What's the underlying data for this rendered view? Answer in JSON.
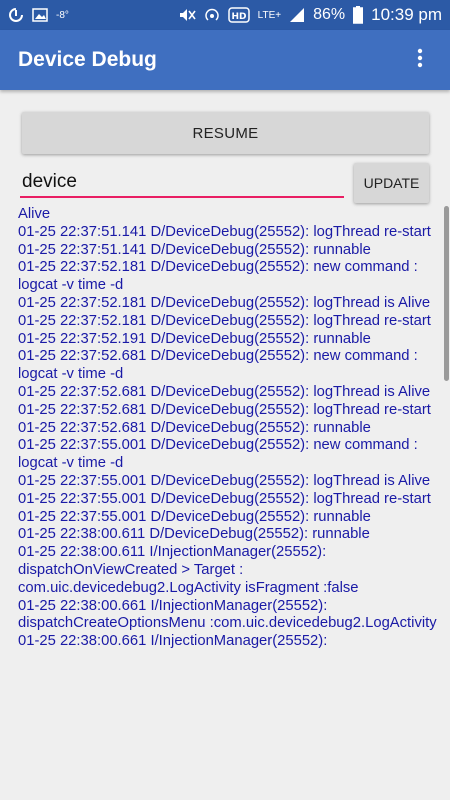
{
  "status_bar": {
    "temperature": "-8°",
    "network": "LTE+",
    "battery": "86%",
    "time": "10:39 pm"
  },
  "app_bar": {
    "title": "Device Debug"
  },
  "controls": {
    "resume_label": "RESUME",
    "filter_value": "device",
    "update_label": "UPDATE"
  },
  "log_lines": [
    "Alive",
    "01-25 22:37:51.141 D/DeviceDebug(25552): logThread re-start",
    "01-25 22:37:51.141 D/DeviceDebug(25552): runnable",
    "01-25 22:37:52.181 D/DeviceDebug(25552): new command : logcat -v time -d",
    "01-25 22:37:52.181 D/DeviceDebug(25552): logThread is Alive",
    "01-25 22:37:52.181 D/DeviceDebug(25552): logThread re-start",
    "01-25 22:37:52.191 D/DeviceDebug(25552): runnable",
    "01-25 22:37:52.681 D/DeviceDebug(25552): new command : logcat -v time -d",
    "01-25 22:37:52.681 D/DeviceDebug(25552): logThread is Alive",
    "01-25 22:37:52.681 D/DeviceDebug(25552): logThread re-start",
    "01-25 22:37:52.681 D/DeviceDebug(25552): runnable",
    "01-25 22:37:55.001 D/DeviceDebug(25552): new command : logcat -v time -d",
    "01-25 22:37:55.001 D/DeviceDebug(25552): logThread is Alive",
    "01-25 22:37:55.001 D/DeviceDebug(25552): logThread re-start",
    "01-25 22:37:55.001 D/DeviceDebug(25552): runnable",
    "01-25 22:38:00.611 D/DeviceDebug(25552): runnable",
    "01-25 22:38:00.611 I/InjectionManager(25552): dispatchOnViewCreated > Target : com.uic.devicedebug2.LogActivity isFragment :false",
    "01-25 22:38:00.661 I/InjectionManager(25552): dispatchCreateOptionsMenu :com.uic.devicedebug2.LogActivity",
    "01-25 22:38:00.661 I/InjectionManager(25552):"
  ]
}
